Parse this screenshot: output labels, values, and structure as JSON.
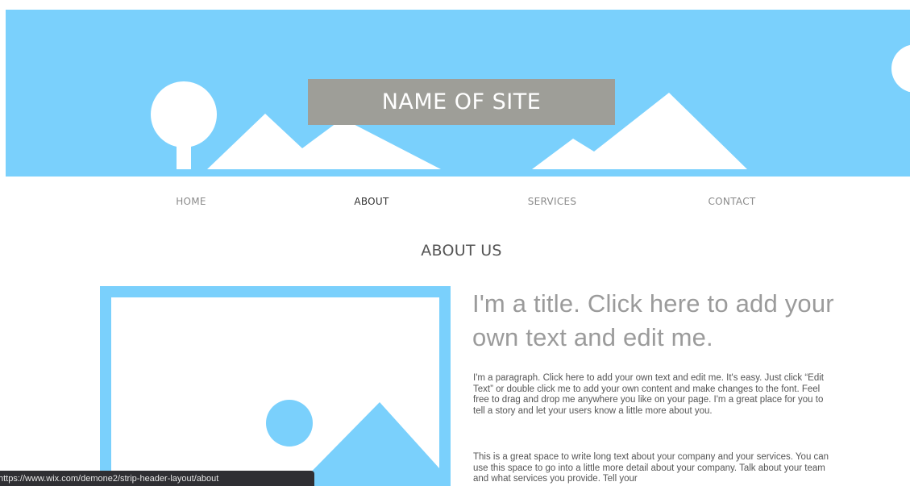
{
  "header": {
    "site_name": "NAME OF SITE"
  },
  "nav": {
    "items": [
      {
        "label": "HOME",
        "active": false
      },
      {
        "label": "ABOUT",
        "active": true
      },
      {
        "label": "SERVICES",
        "active": false
      },
      {
        "label": "CONTACT",
        "active": false
      }
    ]
  },
  "section": {
    "title": "ABOUT US"
  },
  "content": {
    "title": "I'm a title. Click here to add your own text and edit me.",
    "paragraph_1": "I'm a paragraph. Click here to add your own text and edit me. It's easy. Just click “Edit Text” or double click me to add your own content and make changes to the font. Feel free to drag and drop me anywhere you like on your page. I'm a great place for you to tell a story and let your users know a little more about you.",
    "paragraph_2": "This is a great space to write long text about your company and your services. You can use this space to go into a little more detail about your company. Talk about your team and what services you provide. Tell your"
  },
  "image": {
    "icon": "image-placeholder-icon"
  },
  "status_bar": {
    "url": "https://www.wix.com/demone2/strip-header-layout/about"
  },
  "colors": {
    "accent": "#7ad0fc",
    "site_name_bg": "#9e9e98",
    "text": "#555555",
    "title": "#9b9b9b"
  }
}
